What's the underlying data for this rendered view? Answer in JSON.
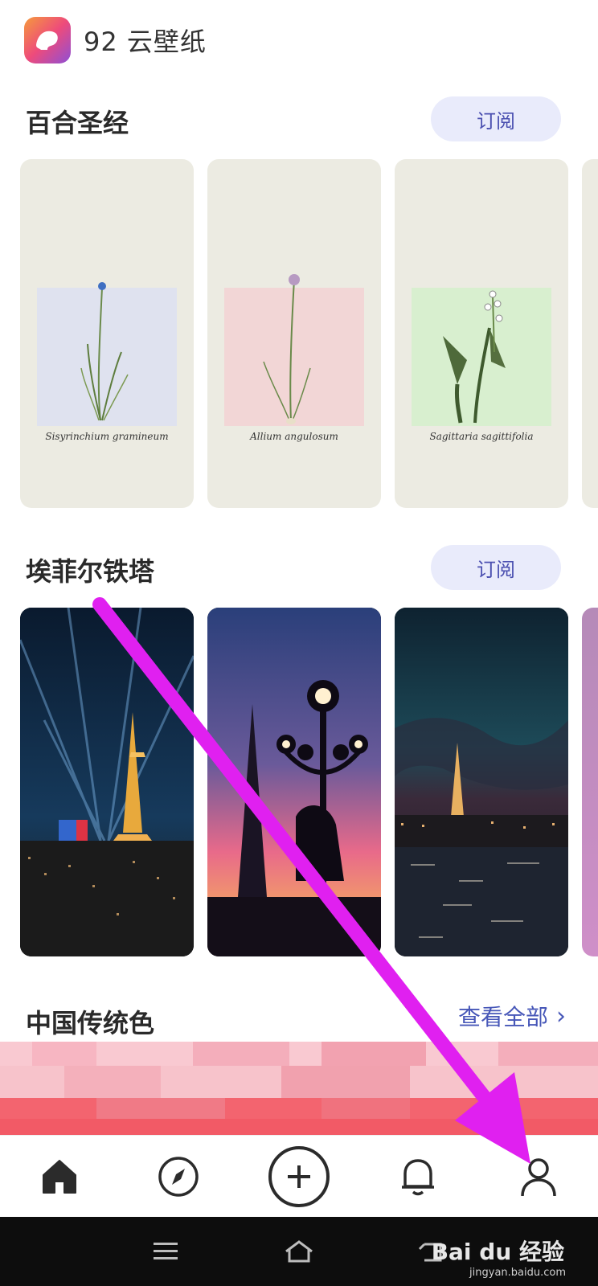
{
  "header": {
    "app_name": "92 云壁纸",
    "logo_icon": "app-logo-icon"
  },
  "sections": [
    {
      "title": "百合圣经",
      "action": "订阅",
      "cards": [
        {
          "caption": "Sisyrinchium gramineum",
          "swatch": "#dfe2ef"
        },
        {
          "caption": "Allium angulosum",
          "swatch": "#f2d6d6"
        },
        {
          "caption": "Sagittaria sagittifolia",
          "swatch": "#d8efcf"
        }
      ]
    },
    {
      "title": "埃菲尔铁塔",
      "action": "订阅",
      "cards": [
        {},
        {},
        {}
      ]
    },
    {
      "title": "中国传统色",
      "action": "查看全部"
    }
  ],
  "bottom_nav": {
    "items": [
      {
        "name": "home",
        "icon": "home-icon",
        "active": true
      },
      {
        "name": "discover",
        "icon": "compass-icon"
      },
      {
        "name": "create",
        "icon": "plus-circle-icon"
      },
      {
        "name": "notifications",
        "icon": "bell-icon"
      },
      {
        "name": "profile",
        "icon": "user-icon"
      }
    ]
  },
  "system_bar": {
    "watermark": "Bai du 经验",
    "watermark_url": "jingyan.baidu.com"
  },
  "colors": {
    "accent": "#4757b8",
    "subscribe_bg": "#e9ebfb",
    "arrow": "#e020f0"
  }
}
